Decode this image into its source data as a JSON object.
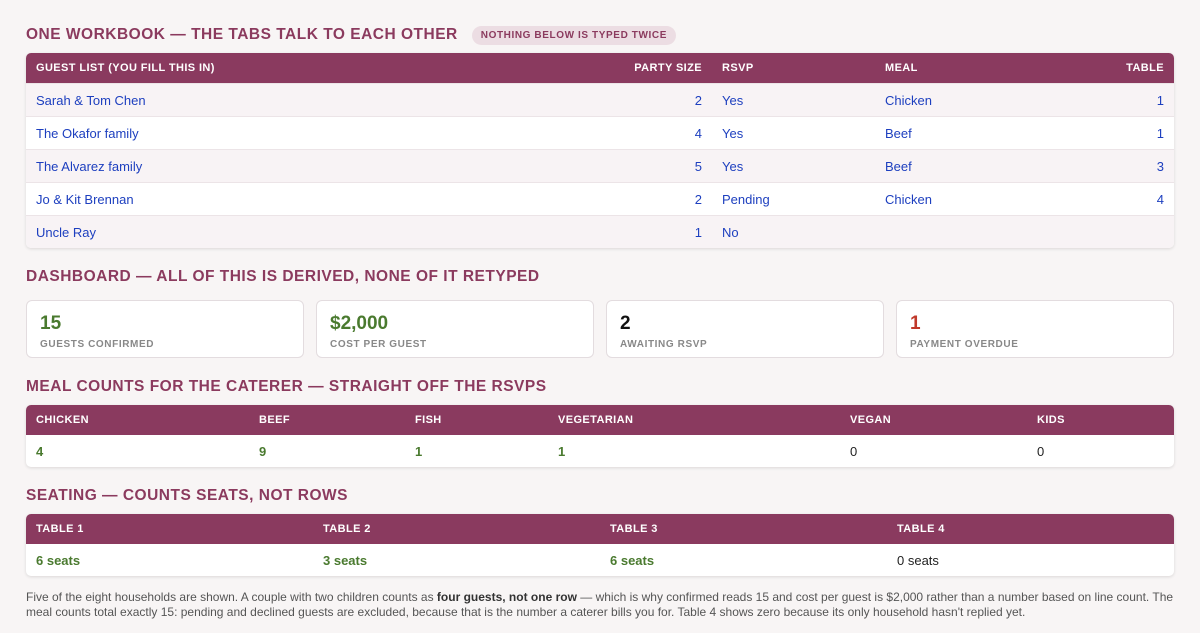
{
  "header": {
    "title": "ONE WORKBOOK — THE TABS TALK TO EACH OTHER",
    "badge": "NOTHING BELOW IS TYPED TWICE"
  },
  "guest_table": {
    "columns": [
      "GUEST LIST (YOU FILL THIS IN)",
      "PARTY SIZE",
      "RSVP",
      "MEAL",
      "TABLE"
    ],
    "rows": [
      {
        "guest": "Sarah & Tom Chen",
        "party": "2",
        "rsvp": "Yes",
        "meal": "Chicken",
        "table": "1"
      },
      {
        "guest": "The Okafor family",
        "party": "4",
        "rsvp": "Yes",
        "meal": "Beef",
        "table": "1"
      },
      {
        "guest": "The Alvarez family",
        "party": "5",
        "rsvp": "Yes",
        "meal": "Beef",
        "table": "3"
      },
      {
        "guest": "Jo & Kit Brennan",
        "party": "2",
        "rsvp": "Pending",
        "meal": "Chicken",
        "table": "4"
      },
      {
        "guest": "Uncle Ray",
        "party": "1",
        "rsvp": "No",
        "meal": "",
        "table": ""
      }
    ]
  },
  "dashboard": {
    "title": "DASHBOARD — ALL OF THIS IS DERIVED, NONE OF IT RETYPED",
    "metrics": [
      {
        "value": "15",
        "label": "GUESTS CONFIRMED",
        "color": "#4a7a2f"
      },
      {
        "value": "$2,000",
        "label": "COST PER GUEST",
        "color": "#4a7a2f"
      },
      {
        "value": "2",
        "label": "AWAITING RSVP",
        "color": "#111111"
      },
      {
        "value": "1",
        "label": "PAYMENT OVERDUE",
        "color": "#c0392b"
      }
    ]
  },
  "meals": {
    "title": "MEAL COUNTS FOR THE CATERER — STRAIGHT OFF THE RSVPS",
    "columns": [
      "CHICKEN",
      "BEEF",
      "FISH",
      "VEGETARIAN",
      "VEGAN",
      "KIDS"
    ],
    "values": [
      "4",
      "9",
      "1",
      "1",
      "0",
      "0"
    ]
  },
  "seating": {
    "title": "SEATING — COUNTS SEATS, NOT ROWS",
    "columns": [
      "TABLE 1",
      "TABLE 2",
      "TABLE 3",
      "TABLE 4"
    ],
    "values": [
      "6 seats",
      "3 seats",
      "6 seats",
      "0 seats"
    ]
  },
  "notes": {
    "part1": "Five of the eight households are shown. A couple with two children counts as ",
    "bold": "four guests, not one row",
    "part2": " — which is why confirmed reads 15 and cost per guest is $2,000 rather than a number based on line count. The meal counts total exactly 15: pending and declined guests are excluded, because that is the number a caterer bills you for. Table 4 shows zero because its only household hasn't replied yet."
  }
}
